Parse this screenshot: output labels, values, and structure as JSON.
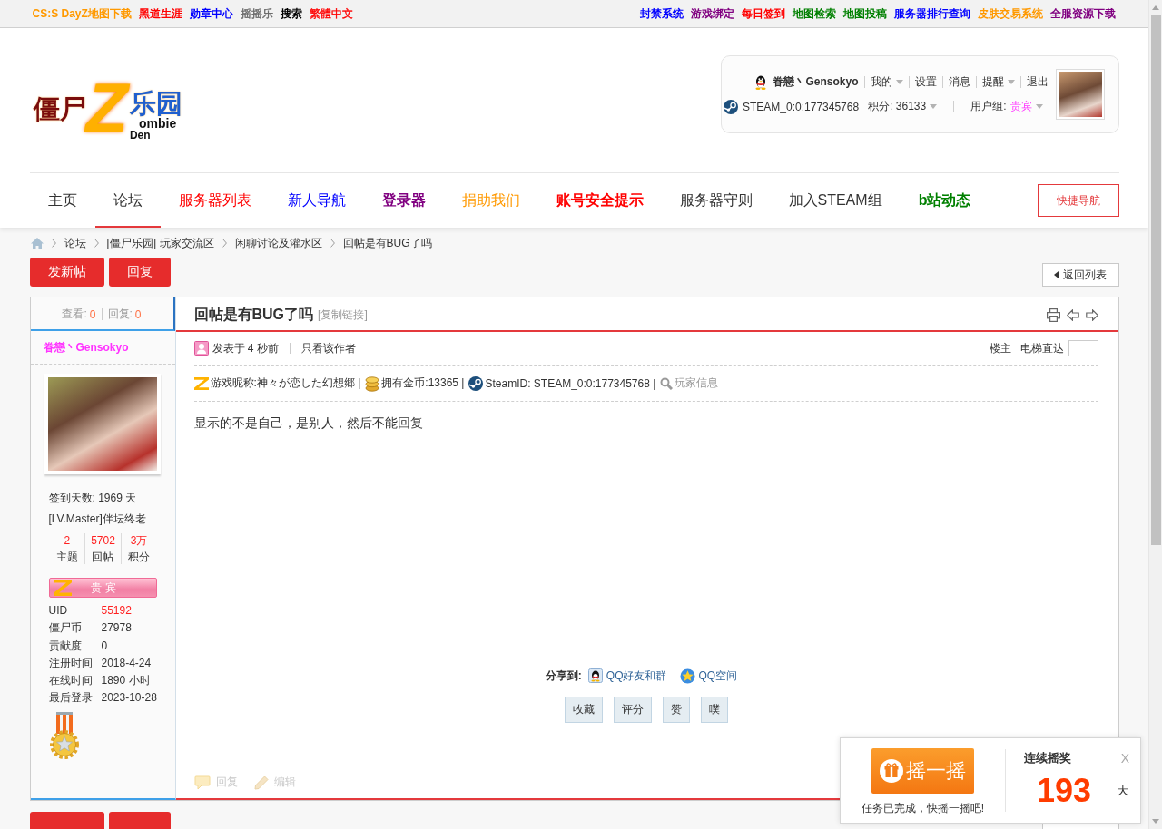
{
  "top_bar": {
    "left_links": [
      {
        "label": "CS:S DayZ地图下载",
        "color": "#ff9900",
        "bold": true
      },
      {
        "label": "黑道生涯",
        "color": "#ff0000",
        "bold": true
      },
      {
        "label": "勋章中心",
        "color": "#0000ff",
        "bold": true
      },
      {
        "label": "摇摇乐",
        "color": "#666666",
        "bold": false
      },
      {
        "label": "搜索",
        "color": "#000000",
        "bold": true
      },
      {
        "label": "繁體中文",
        "color": "#ff0000",
        "bold": false
      }
    ],
    "right_links": [
      {
        "label": "封禁系统",
        "color": "#0000ff",
        "bold": true
      },
      {
        "label": "游戏绑定",
        "color": "#800080",
        "bold": true
      },
      {
        "label": "每日签到",
        "color": "#ff0000",
        "bold": true
      },
      {
        "label": "地图检索",
        "color": "#008000",
        "bold": true
      },
      {
        "label": "地图投稿",
        "color": "#008000",
        "bold": true
      },
      {
        "label": "服务器排行查询",
        "color": "#0000ff",
        "bold": true
      },
      {
        "label": "皮肤交易系统",
        "color": "#ff9900",
        "bold": true
      },
      {
        "label": "全服资源下载",
        "color": "#800080",
        "bold": true
      }
    ]
  },
  "logo": {
    "title_left": "僵尸",
    "mark": "Z",
    "title_right": "乐园",
    "tag_top": "ombie",
    "tag_bottom": "Den"
  },
  "user_panel": {
    "username": "眷戀丶Gensokyo",
    "menu": [
      {
        "label": "我的",
        "dropdown": true
      },
      {
        "label": "设置",
        "dropdown": false
      },
      {
        "label": "消息",
        "dropdown": false
      },
      {
        "label": "提醒",
        "dropdown": true
      },
      {
        "label": "退出",
        "dropdown": false
      }
    ],
    "steam_id": "STEAM_0:0:177345768",
    "points": {
      "label": "积分: 36133",
      "dropdown": true
    },
    "group_label": "用户组:",
    "group": {
      "label": "贵宾",
      "dropdown": true
    }
  },
  "nav": {
    "items": [
      {
        "label": "主页",
        "color": "#333333",
        "bold": false,
        "selected": false
      },
      {
        "label": "论坛",
        "color": "#333333",
        "bold": false,
        "selected": true
      },
      {
        "label": "服务器列表",
        "color": "#ff0000",
        "bold": false,
        "selected": false
      },
      {
        "label": "新人导航",
        "color": "#0000ff",
        "bold": false,
        "selected": false
      },
      {
        "label": "登录器",
        "color": "#800080",
        "bold": true,
        "selected": false
      },
      {
        "label": "捐助我们",
        "color": "#ff9900",
        "bold": false,
        "selected": false
      },
      {
        "label": "账号安全提示",
        "color": "#ff0000",
        "bold": true,
        "selected": false
      },
      {
        "label": "服务器守则",
        "color": "#333333",
        "bold": false,
        "selected": false
      },
      {
        "label": "加入STEAM组",
        "color": "#333333",
        "bold": false,
        "selected": false
      },
      {
        "label": "b站动态",
        "color": "#008000",
        "bold": true,
        "selected": false
      }
    ],
    "quick_nav": "快捷导航"
  },
  "breadcrumb": [
    "论坛",
    "[僵尸乐园] 玩家交流区",
    "闲聊讨论及灌水区",
    "回帖是有BUG了吗"
  ],
  "actions": {
    "new_thread": "发新帖",
    "reply": "回复",
    "back": "返回列表"
  },
  "thread": {
    "views_label": "查看:",
    "views": "0",
    "replies_label": "回复:",
    "replies": "0",
    "title": "回帖是有BUG了吗",
    "copy_link": "[复制链接]"
  },
  "author": {
    "name": "眷戀丶Gensokyo",
    "sign_days": "签到天数: 1969 天",
    "level": "[LV.Master]伴坛终老",
    "stats": [
      {
        "value": "2",
        "label": "主题"
      },
      {
        "value": "5702",
        "label": "回帖"
      },
      {
        "value": "3万",
        "label": "积分"
      }
    ],
    "group_badge": "贵 宾",
    "profile": [
      {
        "label": "UID",
        "value": "55192",
        "highlight": true
      },
      {
        "label": "僵尸币",
        "value": "27978",
        "highlight": false
      },
      {
        "label": "贡献度",
        "value": "0",
        "highlight": false
      },
      {
        "label": "注册时间",
        "value": "2018-4-24",
        "highlight": false
      },
      {
        "label": "在线时间",
        "value": "1890 小时",
        "highlight": false
      },
      {
        "label": "最后登录",
        "value": "2023-10-28",
        "highlight": false
      }
    ]
  },
  "post": {
    "posted": "发表于 4 秒前",
    "only_author": "只看该作者",
    "floor": "楼主",
    "jump_label": "电梯直达",
    "info": [
      {
        "kind": "nickname",
        "text": "游戏昵称:神々が恋した幻想郷 |"
      },
      {
        "kind": "coins",
        "text": "拥有金币:13365 |"
      },
      {
        "kind": "steam",
        "text": "SteamID: STEAM_0:0:177345768 |"
      },
      {
        "kind": "player",
        "text": "玩家信息"
      }
    ],
    "body": "显示的不是自己，是别人，然后不能回复",
    "share_label": "分享到:",
    "share": [
      {
        "kind": "qq",
        "label": "QQ好友和群"
      },
      {
        "kind": "qzone",
        "label": "QQ空间"
      }
    ],
    "buttons": [
      "收藏",
      "评分",
      "赞",
      "噗"
    ],
    "footer": [
      {
        "kind": "reply",
        "label": "回复"
      },
      {
        "kind": "edit",
        "label": "编辑"
      }
    ]
  },
  "lottery_popup": {
    "button": "摇一摇",
    "message": "任务已完成，快摇一摇吧!",
    "title": "连续摇奖",
    "close": "X",
    "days": "193",
    "unit": "天"
  }
}
